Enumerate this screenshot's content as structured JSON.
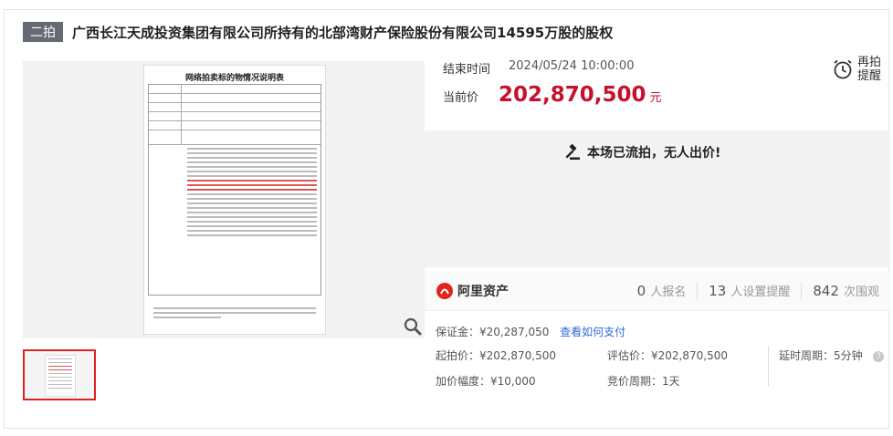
{
  "header": {
    "badge": "二拍",
    "title": "广西长江天成投资集团有限公司所持有的北部湾财产保险股份有限公司14595万股的股权"
  },
  "preview": {
    "doc_title": "网络拍卖标的物情况说明表"
  },
  "auction": {
    "end_label": "结束时间",
    "end_value": "2024/05/24 10:00:00",
    "remind_label": "再拍提醒",
    "price_label": "当前价",
    "price_value": "202,870,500",
    "price_unit": "元",
    "status": "本场已流拍，无人出价!"
  },
  "platform": {
    "name": "阿里资产",
    "stats": [
      {
        "num": "0",
        "label": "人报名"
      },
      {
        "num": "13",
        "label": "人设置提醒"
      },
      {
        "num": "842",
        "label": "次围观"
      }
    ]
  },
  "details": {
    "deposit": "保证金：¥20,287,050",
    "deposit_link": "查看如何支付",
    "start_price": "起拍价：¥202,870,500",
    "appraisal": "评估价：¥202,870,500",
    "delay": "延时周期：5分钟",
    "increment": "加价幅度：¥10,000",
    "bid_cycle": "竞价周期：1天"
  },
  "colors": {
    "price": "#c8102e",
    "link": "#2a6bd3",
    "badge_bg": "#666a73"
  }
}
